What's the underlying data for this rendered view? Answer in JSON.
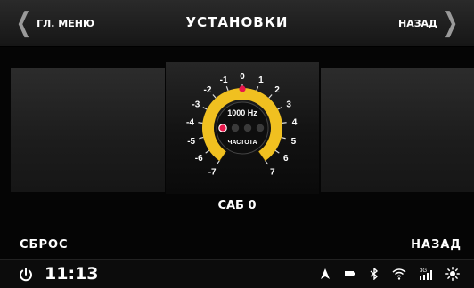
{
  "header": {
    "main_menu_label": "ГЛ. МЕНЮ",
    "title": "УСТАНОВКИ",
    "back_label": "НАЗАД"
  },
  "dial": {
    "frequency": "1000 Hz",
    "mode_label": "ЧАСТОТА",
    "scale_left": [
      "-7",
      "-6",
      "-5",
      "-4",
      "-3",
      "-2",
      "-1"
    ],
    "scale_top": "0",
    "scale_right": [
      "1",
      "2",
      "3",
      "4",
      "5",
      "6",
      "7"
    ],
    "current_value": 0,
    "selected_dot_index": 0,
    "accent_color": "#f0c020",
    "marker_color": "#e8174b"
  },
  "sub_label": "САБ 0",
  "footer": {
    "reset_label": "СБРОС",
    "back_label": "НАЗАД"
  },
  "statusbar": {
    "time": "11:13",
    "network_label": "3G",
    "icons": [
      "power-icon",
      "navigation-icon",
      "battery-icon",
      "bluetooth-icon",
      "wifi-icon",
      "cellular-icon",
      "brightness-icon"
    ]
  }
}
